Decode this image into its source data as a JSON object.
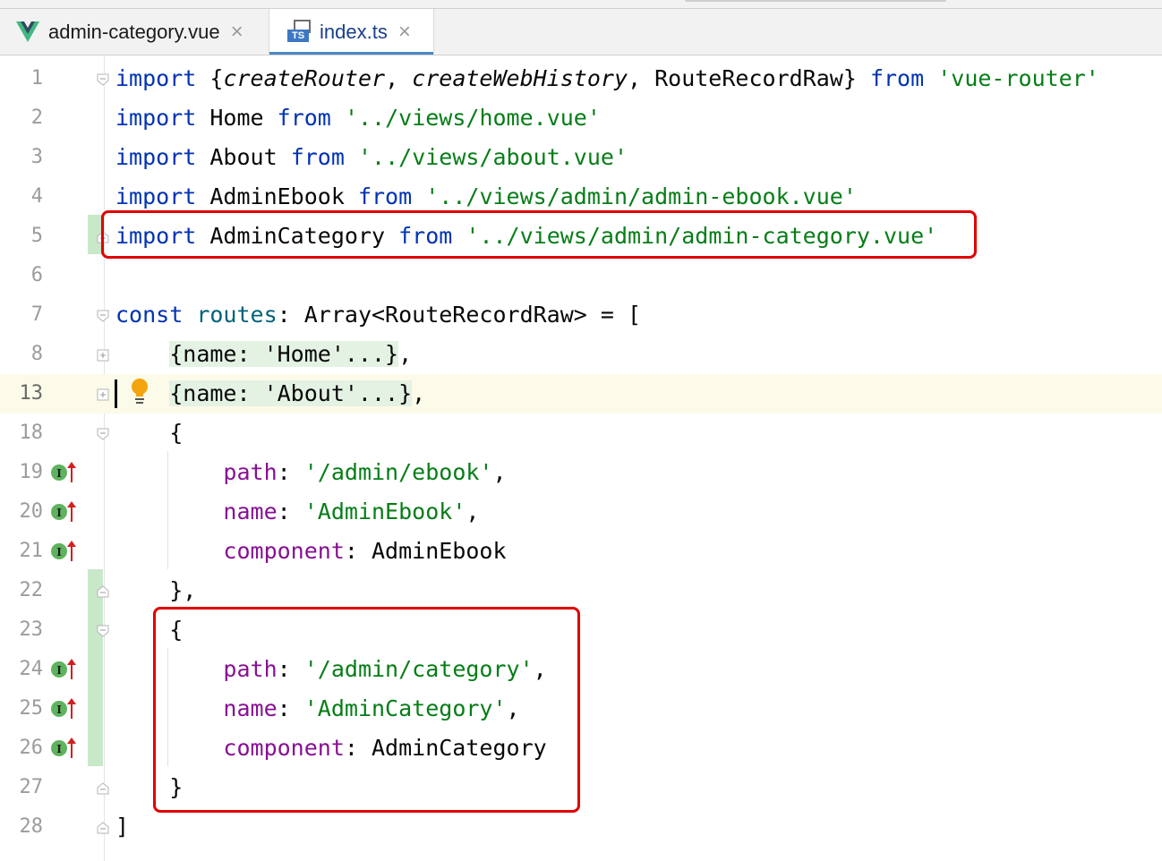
{
  "tabs": [
    {
      "label": "admin-category.vue",
      "icon": "vue-icon",
      "active": false
    },
    {
      "label": "index.ts",
      "icon": "typescript-file-icon",
      "active": true
    }
  ],
  "colors": {
    "keyword": "#0033b3",
    "string": "#067d17",
    "property": "#871094",
    "highlight": "#e00000",
    "tab_accent": "#4a88c7"
  },
  "lines": [
    {
      "n": "1"
    },
    {
      "n": "2"
    },
    {
      "n": "3"
    },
    {
      "n": "4"
    },
    {
      "n": "5"
    },
    {
      "n": "6"
    },
    {
      "n": "7"
    },
    {
      "n": "8"
    },
    {
      "n": "13"
    },
    {
      "n": "18"
    },
    {
      "n": "19"
    },
    {
      "n": "20"
    },
    {
      "n": "21"
    },
    {
      "n": "22"
    },
    {
      "n": "23"
    },
    {
      "n": "24"
    },
    {
      "n": "25"
    },
    {
      "n": "26"
    },
    {
      "n": "27"
    },
    {
      "n": "28"
    }
  ],
  "code": {
    "import": "import",
    "from": "from",
    "const": "const",
    "l1_open": "{",
    "l1_create_router": "createRouter",
    "l1_comma1": ", ",
    "l1_create_web_history": "createWebHistory",
    "l1_rest": ", RouteRecordRaw}",
    "l1_module": "'vue-router'",
    "l2_name": "Home",
    "l2_path": "'../views/home.vue'",
    "l3_name": "About",
    "l3_path": "'../views/about.vue'",
    "l4_name": "AdminEbook",
    "l4_path": "'../views/admin/admin-ebook.vue'",
    "l5_name": "AdminCategory",
    "l5_path": "'../views/admin/admin-category.vue'",
    "l7_routes": "routes",
    "l7_rest": ": Array<RouteRecordRaw> = [",
    "l8_fold": "{name: 'Home'...}",
    "l13_fold": "{name: 'About'...}",
    "comma": ",",
    "open_brace": "{",
    "close_brace_comma": "},",
    "close_brace": "}",
    "close_bracket": "]",
    "key_path": "path",
    "key_name": "name",
    "key_component": "component",
    "colon": ": ",
    "l19_value": "'/admin/ebook'",
    "l20_value": "'AdminEbook'",
    "l21_value": "AdminEbook",
    "l24_value": "'/admin/category'",
    "l25_value": "'AdminCategory'",
    "l26_value": "AdminCategory"
  }
}
